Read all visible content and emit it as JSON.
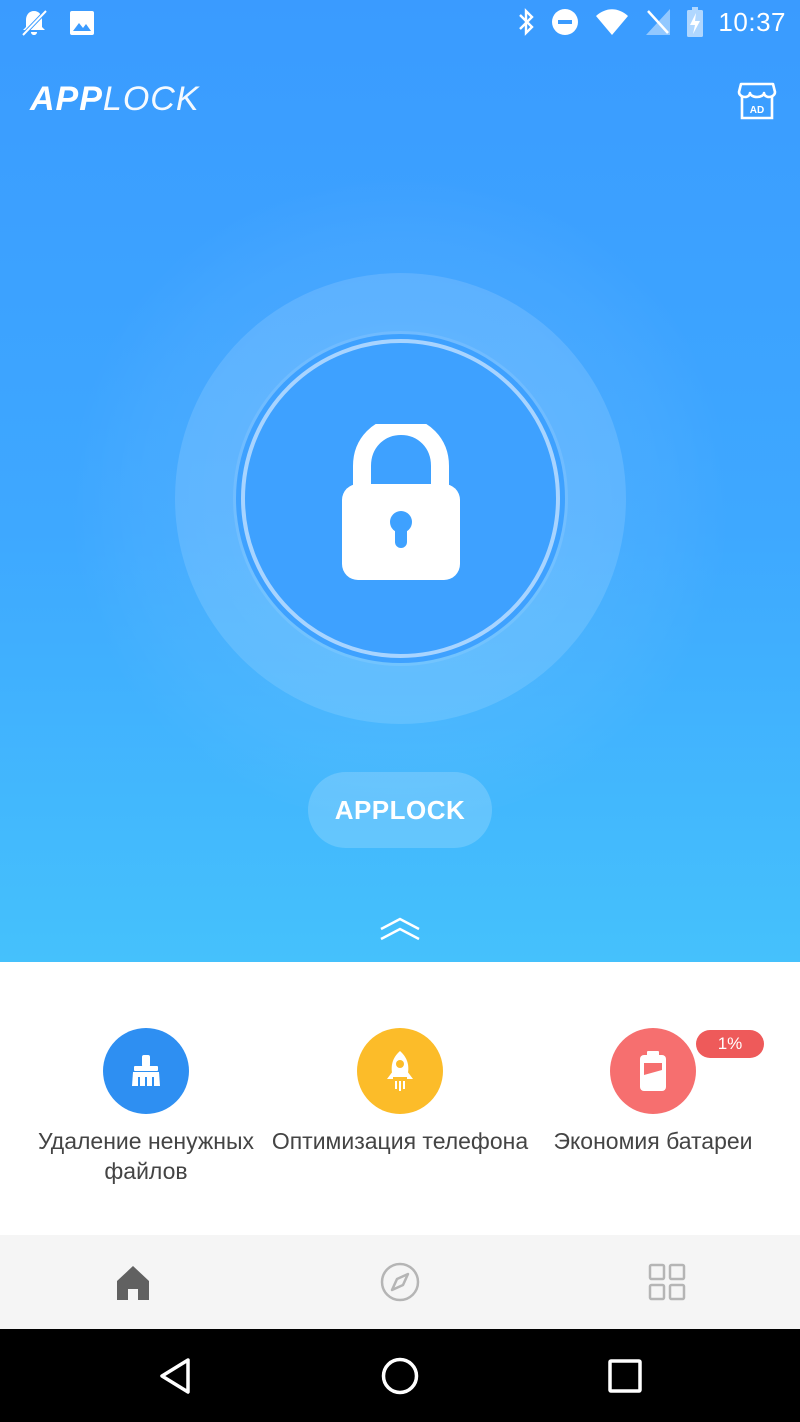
{
  "status_bar": {
    "time": "10:37",
    "left_icons": [
      "notifications-off-icon",
      "image-icon"
    ],
    "right_icons": [
      "bluetooth-icon",
      "do-not-disturb-icon",
      "wifi-icon",
      "no-signal-icon",
      "battery-charging-icon"
    ]
  },
  "app_bar": {
    "title_bold": "APP",
    "title_thin": "LOCK",
    "ad_label": "AD"
  },
  "hero": {
    "lock_icon": "padlock-icon",
    "button_label": "APPLOCK",
    "expand_icon": "double-chevron-up-icon"
  },
  "features": [
    {
      "label": "Удаление ненужных файлов",
      "icon": "broom-icon",
      "color": "#2e8ff2"
    },
    {
      "label": "Оптимизация телефона",
      "icon": "rocket-icon",
      "color": "#fcbc29"
    },
    {
      "label": "Экономия батареи",
      "icon": "battery-icon",
      "color": "#f66f6f",
      "badge": "1%"
    }
  ],
  "bottom_nav": [
    {
      "icon": "home-icon",
      "active": true
    },
    {
      "icon": "compass-icon",
      "active": false
    },
    {
      "icon": "apps-grid-icon",
      "active": false
    }
  ],
  "system_nav": [
    "back-icon",
    "home-circle-icon",
    "recents-icon"
  ],
  "colors": {
    "hero_top": "#3a9bff",
    "hero_bottom": "#45c1fc",
    "badge": "#ee5a5a"
  }
}
